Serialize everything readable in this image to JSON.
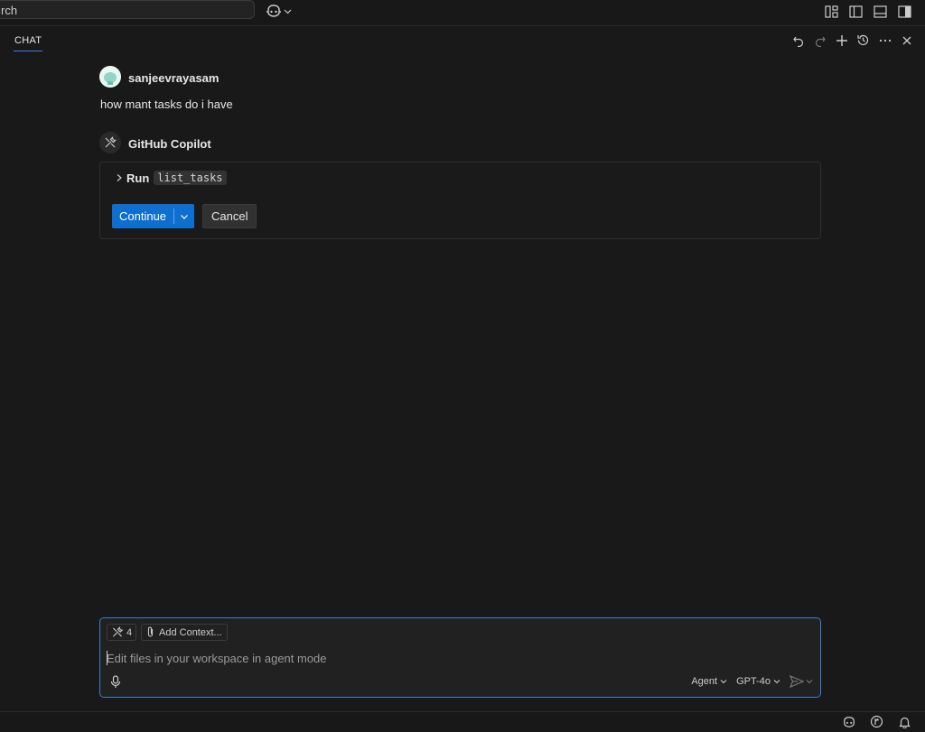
{
  "topbar": {
    "search_text": "rch",
    "copilot_icon": "copilot-icon",
    "layout_icons": [
      "customize-layout-icon",
      "toggle-primary-sidebar-icon",
      "toggle-panel-icon",
      "toggle-secondary-sidebar-icon"
    ]
  },
  "chat": {
    "tab_label": "CHAT",
    "actions": [
      "undo-icon",
      "redo-icon",
      "new-chat-icon",
      "history-icon",
      "more-icon",
      "close-icon"
    ]
  },
  "conversation": {
    "user": {
      "name": "sanjeevrayasam",
      "message": "how mant tasks do i have"
    },
    "assistant": {
      "name": "GitHub Copilot",
      "tool_call": {
        "label": "Run",
        "tool_name": "list_tasks",
        "continue_label": "Continue",
        "cancel_label": "Cancel"
      }
    }
  },
  "input": {
    "tools_count": "4",
    "add_context_label": "Add Context...",
    "placeholder": "Edit files in your workspace in agent mode",
    "mode": "Agent",
    "model": "GPT-4o"
  },
  "colors": {
    "accent": "#0e6fd1",
    "focus_border": "#3a7fd6",
    "background": "#191919"
  }
}
